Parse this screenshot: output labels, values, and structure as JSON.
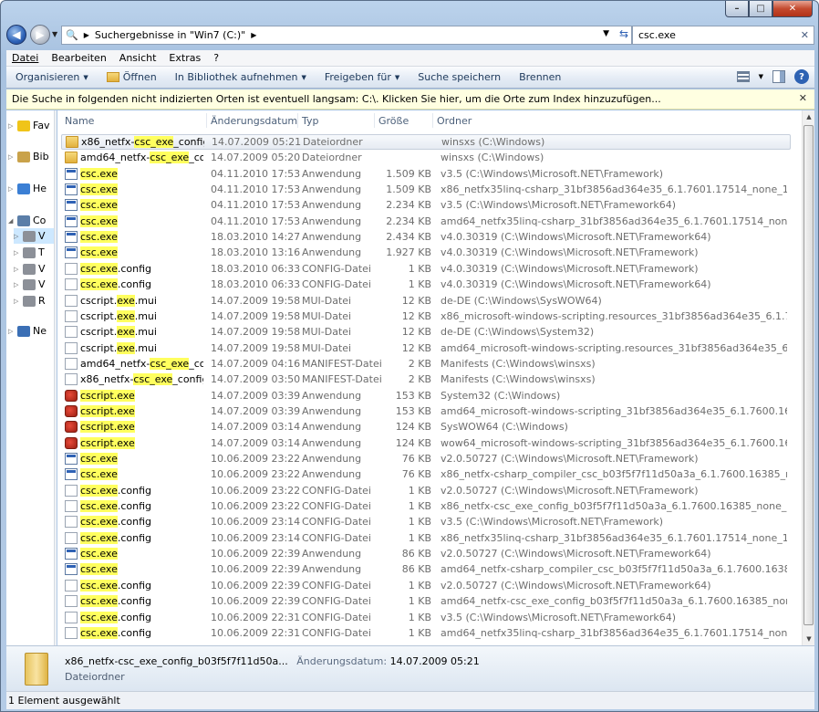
{
  "window": {
    "address_path": "Suchergebnisse in \"Win7 (C:)\"",
    "search_value": "csc.exe"
  },
  "menu": [
    "Datei",
    "Bearbeiten",
    "Ansicht",
    "Extras",
    "?"
  ],
  "commands": {
    "organize": "Organisieren",
    "open": "Öffnen",
    "include_library": "In Bibliothek aufnehmen",
    "share": "Freigeben für",
    "save_search": "Suche speichern",
    "burn": "Brennen"
  },
  "infobar": {
    "text": "Die Suche in folgenden nicht indizierten Orten ist eventuell langsam: C:\\. Klicken Sie hier, um die Orte zum Index hinzuzufügen..."
  },
  "nav": [
    {
      "label": "Fav",
      "icon": "star-icon"
    },
    {
      "label": "Bib",
      "icon": "library-icon"
    },
    {
      "label": "He",
      "icon": "homegroup-icon"
    },
    {
      "label": "Co",
      "icon": "computer-icon"
    },
    {
      "label": "V",
      "icon": "drive-icon"
    },
    {
      "label": "T",
      "icon": "drive-icon"
    },
    {
      "label": "V",
      "icon": "drive-icon"
    },
    {
      "label": "V",
      "icon": "drive-icon"
    },
    {
      "label": "R",
      "icon": "drive-icon"
    },
    {
      "label": "Ne",
      "icon": "network-icon"
    }
  ],
  "columns": {
    "name": "Name",
    "date": "Änderungsdatum",
    "type": "Typ",
    "size": "Größe",
    "folder": "Ordner"
  },
  "files": [
    {
      "icon": "folder",
      "pre": "x86_netfx-",
      "hl": "csc_exe",
      "post": "_config_b0...",
      "date": "14.07.2009 05:21",
      "type": "Dateiordner",
      "size": "",
      "dir": "winsxs (C:\\Windows)"
    },
    {
      "icon": "folder",
      "pre": "amd64_netfx-",
      "hl": "csc_exe",
      "post": "_config...",
      "date": "14.07.2009 05:20",
      "type": "Dateiordner",
      "size": "",
      "dir": "winsxs (C:\\Windows)"
    },
    {
      "icon": "app",
      "pre": "",
      "hl": "csc.exe",
      "post": "",
      "date": "04.11.2010 17:53",
      "type": "Anwendung",
      "size": "1.509 KB",
      "dir": "v3.5 (C:\\Windows\\Microsoft.NET\\Framework)"
    },
    {
      "icon": "app",
      "pre": "",
      "hl": "csc.exe",
      "post": "",
      "date": "04.11.2010 17:53",
      "type": "Anwendung",
      "size": "1.509 KB",
      "dir": "x86_netfx35linq-csharp_31bf3856ad364e35_6.1.7601.17514_none_193318f5726bf1d7 (C:..."
    },
    {
      "icon": "app",
      "pre": "",
      "hl": "csc.exe",
      "post": "",
      "date": "04.11.2010 17:53",
      "type": "Anwendung",
      "size": "2.234 KB",
      "dir": "v3.5 (C:\\Windows\\Microsoft.NET\\Framework64)"
    },
    {
      "icon": "app",
      "pre": "",
      "hl": "csc.exe",
      "post": "",
      "date": "04.11.2010 17:53",
      "type": "Anwendung",
      "size": "2.234 KB",
      "dir": "amd64_netfx35linq-csharp_31bf3856ad364e35_6.1.7601.17514_none_7551b4792ac9630..."
    },
    {
      "icon": "app",
      "pre": "",
      "hl": "csc.exe",
      "post": "",
      "date": "18.03.2010 14:27",
      "type": "Anwendung",
      "size": "2.434 KB",
      "dir": "v4.0.30319 (C:\\Windows\\Microsoft.NET\\Framework64)"
    },
    {
      "icon": "app",
      "pre": "",
      "hl": "csc.exe",
      "post": "",
      "date": "18.03.2010 13:16",
      "type": "Anwendung",
      "size": "1.927 KB",
      "dir": "v4.0.30319 (C:\\Windows\\Microsoft.NET\\Framework)"
    },
    {
      "icon": "doc",
      "pre": "",
      "hl": "csc.exe",
      "post": ".config",
      "date": "18.03.2010 06:33",
      "type": "CONFIG-Datei",
      "size": "1 KB",
      "dir": "v4.0.30319 (C:\\Windows\\Microsoft.NET\\Framework)"
    },
    {
      "icon": "doc",
      "pre": "",
      "hl": "csc.exe",
      "post": ".config",
      "date": "18.03.2010 06:33",
      "type": "CONFIG-Datei",
      "size": "1 KB",
      "dir": "v4.0.30319 (C:\\Windows\\Microsoft.NET\\Framework64)"
    },
    {
      "icon": "doc",
      "pre": "cscript.",
      "hl": "exe",
      "post": ".mui",
      "date": "14.07.2009 19:58",
      "type": "MUI-Datei",
      "size": "12 KB",
      "dir": "de-DE (C:\\Windows\\SysWOW64)"
    },
    {
      "icon": "doc",
      "pre": "cscript.",
      "hl": "exe",
      "post": ".mui",
      "date": "14.07.2009 19:58",
      "type": "MUI-Datei",
      "size": "12 KB",
      "dir": "x86_microsoft-windows-scripting.resources_31bf3856ad364e35_6.1.7600.16385_de-de_..."
    },
    {
      "icon": "doc",
      "pre": "cscript.",
      "hl": "exe",
      "post": ".mui",
      "date": "14.07.2009 19:58",
      "type": "MUI-Datei",
      "size": "12 KB",
      "dir": "de-DE (C:\\Windows\\System32)"
    },
    {
      "icon": "doc",
      "pre": "cscript.",
      "hl": "exe",
      "post": ".mui",
      "date": "14.07.2009 19:58",
      "type": "MUI-Datei",
      "size": "12 KB",
      "dir": "amd64_microsoft-windows-scripting.resources_31bf3856ad364e35_6.1.7600.16385_de-..."
    },
    {
      "icon": "doc",
      "pre": "amd64_netfx-",
      "hl": "csc_exe",
      "post": "_config...",
      "date": "14.07.2009 04:16",
      "type": "MANIFEST-Datei",
      "size": "2 KB",
      "dir": "Manifests (C:\\Windows\\winsxs)"
    },
    {
      "icon": "doc",
      "pre": "x86_netfx-",
      "hl": "csc_exe",
      "post": "_config_b0...",
      "date": "14.07.2009 03:50",
      "type": "MANIFEST-Datei",
      "size": "2 KB",
      "dir": "Manifests (C:\\Windows\\winsxs)"
    },
    {
      "icon": "script",
      "pre": "",
      "hl": "cscript.exe",
      "post": "",
      "date": "14.07.2009 03:39",
      "type": "Anwendung",
      "size": "153 KB",
      "dir": "System32 (C:\\Windows)"
    },
    {
      "icon": "script",
      "pre": "",
      "hl": "cscript.exe",
      "post": "",
      "date": "14.07.2009 03:39",
      "type": "Anwendung",
      "size": "153 KB",
      "dir": "amd64_microsoft-windows-scripting_31bf3856ad364e35_6.1.7600.16385_none_a45d44..."
    },
    {
      "icon": "script",
      "pre": "",
      "hl": "cscript.exe",
      "post": "",
      "date": "14.07.2009 03:14",
      "type": "Anwendung",
      "size": "124 KB",
      "dir": "SysWOW64 (C:\\Windows)"
    },
    {
      "icon": "script",
      "pre": "",
      "hl": "cscript.exe",
      "post": "",
      "date": "14.07.2009 03:14",
      "type": "Anwendung",
      "size": "124 KB",
      "dir": "wow64_microsoft-windows-scripting_31bf3856ad364e35_6.1.7600.16385_none_aeb1ef..."
    },
    {
      "icon": "app",
      "pre": "",
      "hl": "csc.exe",
      "post": "",
      "date": "10.06.2009 23:22",
      "type": "Anwendung",
      "size": "76 KB",
      "dir": "v2.0.50727 (C:\\Windows\\Microsoft.NET\\Framework)"
    },
    {
      "icon": "app",
      "pre": "",
      "hl": "csc.exe",
      "post": "",
      "date": "10.06.2009 23:22",
      "type": "Anwendung",
      "size": "76 KB",
      "dir": "x86_netfx-csharp_compiler_csc_b03f5f7f11d50a3a_6.1.7600.16385_none_d2fff1dae9668..."
    },
    {
      "icon": "doc",
      "pre": "",
      "hl": "csc.exe",
      "post": ".config",
      "date": "10.06.2009 23:22",
      "type": "CONFIG-Datei",
      "size": "1 KB",
      "dir": "v2.0.50727 (C:\\Windows\\Microsoft.NET\\Framework)"
    },
    {
      "icon": "doc",
      "pre": "",
      "hl": "csc.exe",
      "post": ".config",
      "date": "10.06.2009 23:22",
      "type": "CONFIG-Datei",
      "size": "1 KB",
      "dir": "x86_netfx-csc_exe_config_b03f5f7f11d50a3a_6.1.7600.16385_none_5bfb623d555cccb6 (..."
    },
    {
      "icon": "doc",
      "pre": "",
      "hl": "csc.exe",
      "post": ".config",
      "date": "10.06.2009 23:14",
      "type": "CONFIG-Datei",
      "size": "1 KB",
      "dir": "v3.5 (C:\\Windows\\Microsoft.NET\\Framework)"
    },
    {
      "icon": "doc",
      "pre": "",
      "hl": "csc.exe",
      "post": ".config",
      "date": "10.06.2009 23:14",
      "type": "CONFIG-Datei",
      "size": "1 KB",
      "dir": "x86_netfx35linq-csharp_31bf3856ad364e35_6.1.7601.17514_none_193318f5726bf1d7 (C:..."
    },
    {
      "icon": "app",
      "pre": "",
      "hl": "csc.exe",
      "post": "",
      "date": "10.06.2009 22:39",
      "type": "Anwendung",
      "size": "86 KB",
      "dir": "v2.0.50727 (C:\\Windows\\Microsoft.NET\\Framework64)"
    },
    {
      "icon": "app",
      "pre": "",
      "hl": "csc.exe",
      "post": "",
      "date": "10.06.2009 22:39",
      "type": "Anwendung",
      "size": "86 KB",
      "dir": "amd64_netfx-csharp_compiler_csc_b03f5f7f11d50a3a_6.1.7600.16385_none_8b52bb03..."
    },
    {
      "icon": "doc",
      "pre": "",
      "hl": "csc.exe",
      "post": ".config",
      "date": "10.06.2009 22:39",
      "type": "CONFIG-Datei",
      "size": "1 KB",
      "dir": "v2.0.50727 (C:\\Windows\\Microsoft.NET\\Framework64)"
    },
    {
      "icon": "doc",
      "pre": "",
      "hl": "csc.exe",
      "post": ".config",
      "date": "10.06.2009 22:39",
      "type": "CONFIG-Datei",
      "size": "1 KB",
      "dir": "amd64_netfx-csc_exe_config_b03f5f7f11d50a3a_6.1.7600.16385_none_144e2b6640e0a3..."
    },
    {
      "icon": "doc",
      "pre": "",
      "hl": "csc.exe",
      "post": ".config",
      "date": "10.06.2009 22:31",
      "type": "CONFIG-Datei",
      "size": "1 KB",
      "dir": "v3.5 (C:\\Windows\\Microsoft.NET\\Framework64)"
    },
    {
      "icon": "doc",
      "pre": "",
      "hl": "csc.exe",
      "post": ".config",
      "date": "10.06.2009 22:31",
      "type": "CONFIG-Datei",
      "size": "1 KB",
      "dir": "amd64_netfx35linq-csharp_31bf3856ad364e35_6.1.7601.17514_none_7551b4792ac9630..."
    }
  ],
  "details": {
    "name": "x86_netfx-csc_exe_config_b03f5f7f11d50a...",
    "date_label": "Änderungsdatum:",
    "date_value": "14.07.2009 05:21",
    "type": "Dateiordner"
  },
  "status": "1 Element ausgewählt"
}
